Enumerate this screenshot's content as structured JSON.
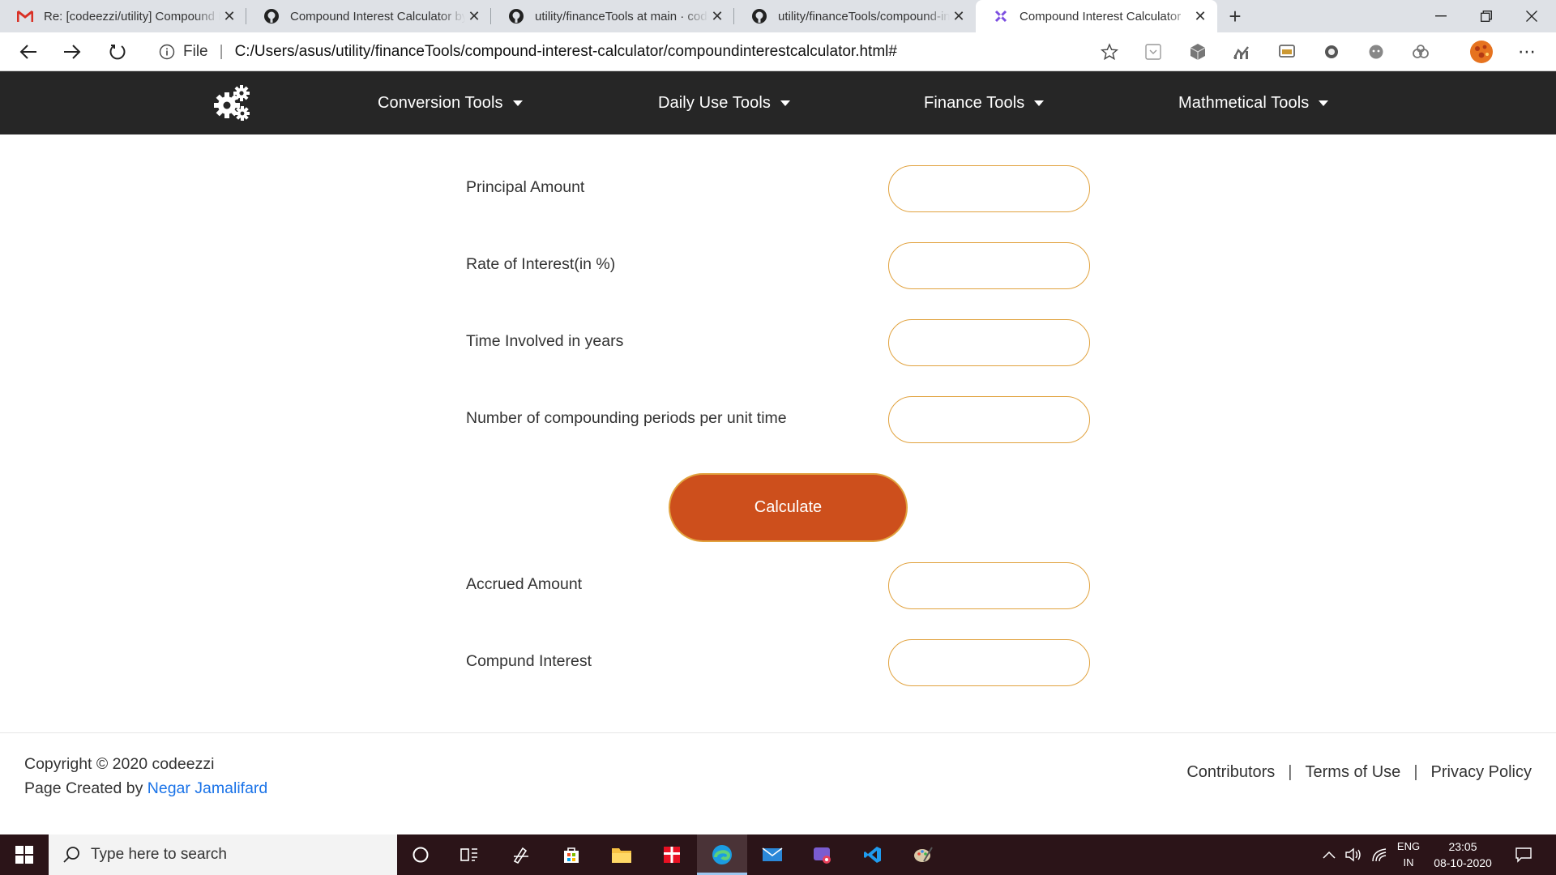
{
  "browser": {
    "tabs": [
      {
        "title": "Re: [codeezzi/utility] Compound Interest Calculator",
        "icon": "gmail-icon"
      },
      {
        "title": "Compound Interest Calculator by",
        "icon": "github-icon"
      },
      {
        "title": "utility/financeTools at main · codeezzi",
        "icon": "github-icon"
      },
      {
        "title": "utility/financeTools/compound-interest",
        "icon": "github-icon"
      },
      {
        "title": "Compound Interest Calculator",
        "icon": "calculator-favicon",
        "active": true
      }
    ],
    "address": {
      "scheme": "File",
      "url": "C:/Users/asus/utility/financeTools/compound-interest-calculator/compoundinterestcalculator.html#"
    }
  },
  "navbar": {
    "items": [
      "Conversion Tools",
      "Daily Use Tools",
      "Finance Tools",
      "Mathmetical Tools"
    ]
  },
  "form": {
    "principal_label": "Principal Amount",
    "rate_label": "Rate of Interest(in %)",
    "time_label": "Time Involved in years",
    "periods_label": "Number of compounding periods per unit time",
    "calculate_label": "Calculate",
    "accrued_label": "Accrued Amount",
    "interest_label": "Compund Interest"
  },
  "footer": {
    "copyright": "Copyright © 2020 codeezzi",
    "created_prefix": "Page Created by",
    "author": "Negar Jamalifard",
    "links": [
      "Contributors",
      "Terms of Use",
      "Privacy Policy"
    ]
  },
  "taskbar": {
    "search_placeholder": "Type here to search",
    "lang_line1": "ENG",
    "lang_line2": "IN",
    "time": "23:05",
    "date": "08-10-2020"
  },
  "colors": {
    "navbar_bg": "#262626",
    "field_border": "#e1a23e",
    "button_bg": "#cd4f1c",
    "link": "#1a73e8"
  }
}
